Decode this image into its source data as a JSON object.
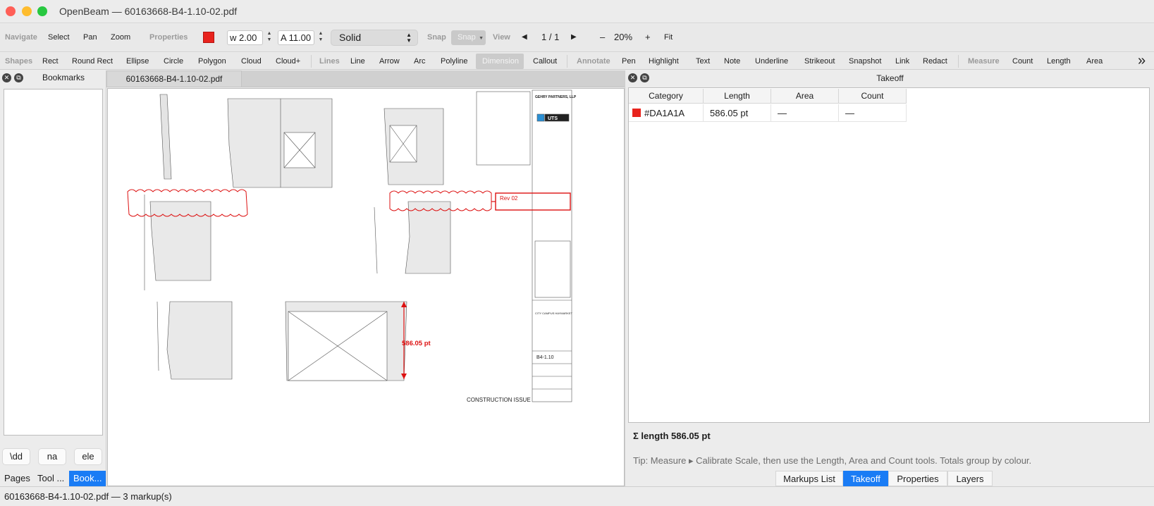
{
  "window": {
    "title": "OpenBeam — 60163668-B4-1.10-02.pdf",
    "traffic_colors": [
      "#ff5f57",
      "#febc2e",
      "#28c840"
    ]
  },
  "toolbar_main": {
    "navigate_label": "Navigate",
    "select_label": "Select",
    "pan_label": "Pan",
    "zoom_label": "Zoom",
    "properties_label": "Properties",
    "color": "#e8231d",
    "width_value": "w 2.00",
    "alpha_value": "A 11.00",
    "line_style": "Solid",
    "snap_label": "Snap",
    "snap_button": "Snap",
    "view_label": "View",
    "prev_page": "◀",
    "page_indicator": "1 / 1",
    "next_page": "▶",
    "zoom_out": "–",
    "zoom_level": "20%",
    "zoom_in": "+",
    "fit_label": "Fit"
  },
  "toolbar_tools": {
    "shapes_label": "Shapes",
    "shapes": [
      "Rect",
      "Round Rect",
      "Ellipse",
      "Circle",
      "Polygon",
      "Cloud",
      "Cloud+"
    ],
    "lines_label": "Lines",
    "lines": [
      "Line",
      "Arrow",
      "Arc",
      "Polyline",
      "Dimension",
      "Callout"
    ],
    "annotate_label": "Annotate",
    "annotate": [
      "Pen",
      "Highlight",
      "Text",
      "Note",
      "Underline",
      "Strikeout",
      "Snapshot",
      "Link",
      "Redact"
    ],
    "measure_label": "Measure",
    "measure": [
      "Count",
      "Length",
      "Area"
    ],
    "overflow": "»"
  },
  "left_panel": {
    "title": "Bookmarks",
    "buttons": [
      "\\dd",
      "na",
      "ele"
    ],
    "tabs": [
      "Pages",
      "Tool ...",
      "Book..."
    ]
  },
  "document": {
    "tab_name": "60163668-B4-1.10-02.pdf",
    "markup_rev_label": "Rev 02",
    "dimension_label": "586.05 pt",
    "stamp_text": "CONSTRUCTION ISSUE",
    "title_block": {
      "firm": "GEHRY PARTNERS, LLP",
      "client_logo": "UTS",
      "sheet_no": "B4-1.10",
      "project": "CITY CAMPUS HAYMARKET"
    }
  },
  "takeoff": {
    "title": "Takeoff",
    "columns": [
      "Category",
      "Length",
      "Area",
      "Count"
    ],
    "rows": [
      {
        "swatch": "#e8231d",
        "category": "#DA1A1A",
        "length": "586.05 pt",
        "area": "—",
        "count": "—"
      }
    ],
    "sum": "Σ length 586.05 pt",
    "tip": "Tip: Measure ▸ Calibrate Scale, then use the Length, Area and Count tools. Totals group by colour.",
    "tabs": [
      "Markups List",
      "Takeoff",
      "Properties",
      "Layers"
    ],
    "active_tab": "Takeoff"
  },
  "status": {
    "text": "60163668-B4-1.10-02.pdf — 3 markup(s)"
  }
}
